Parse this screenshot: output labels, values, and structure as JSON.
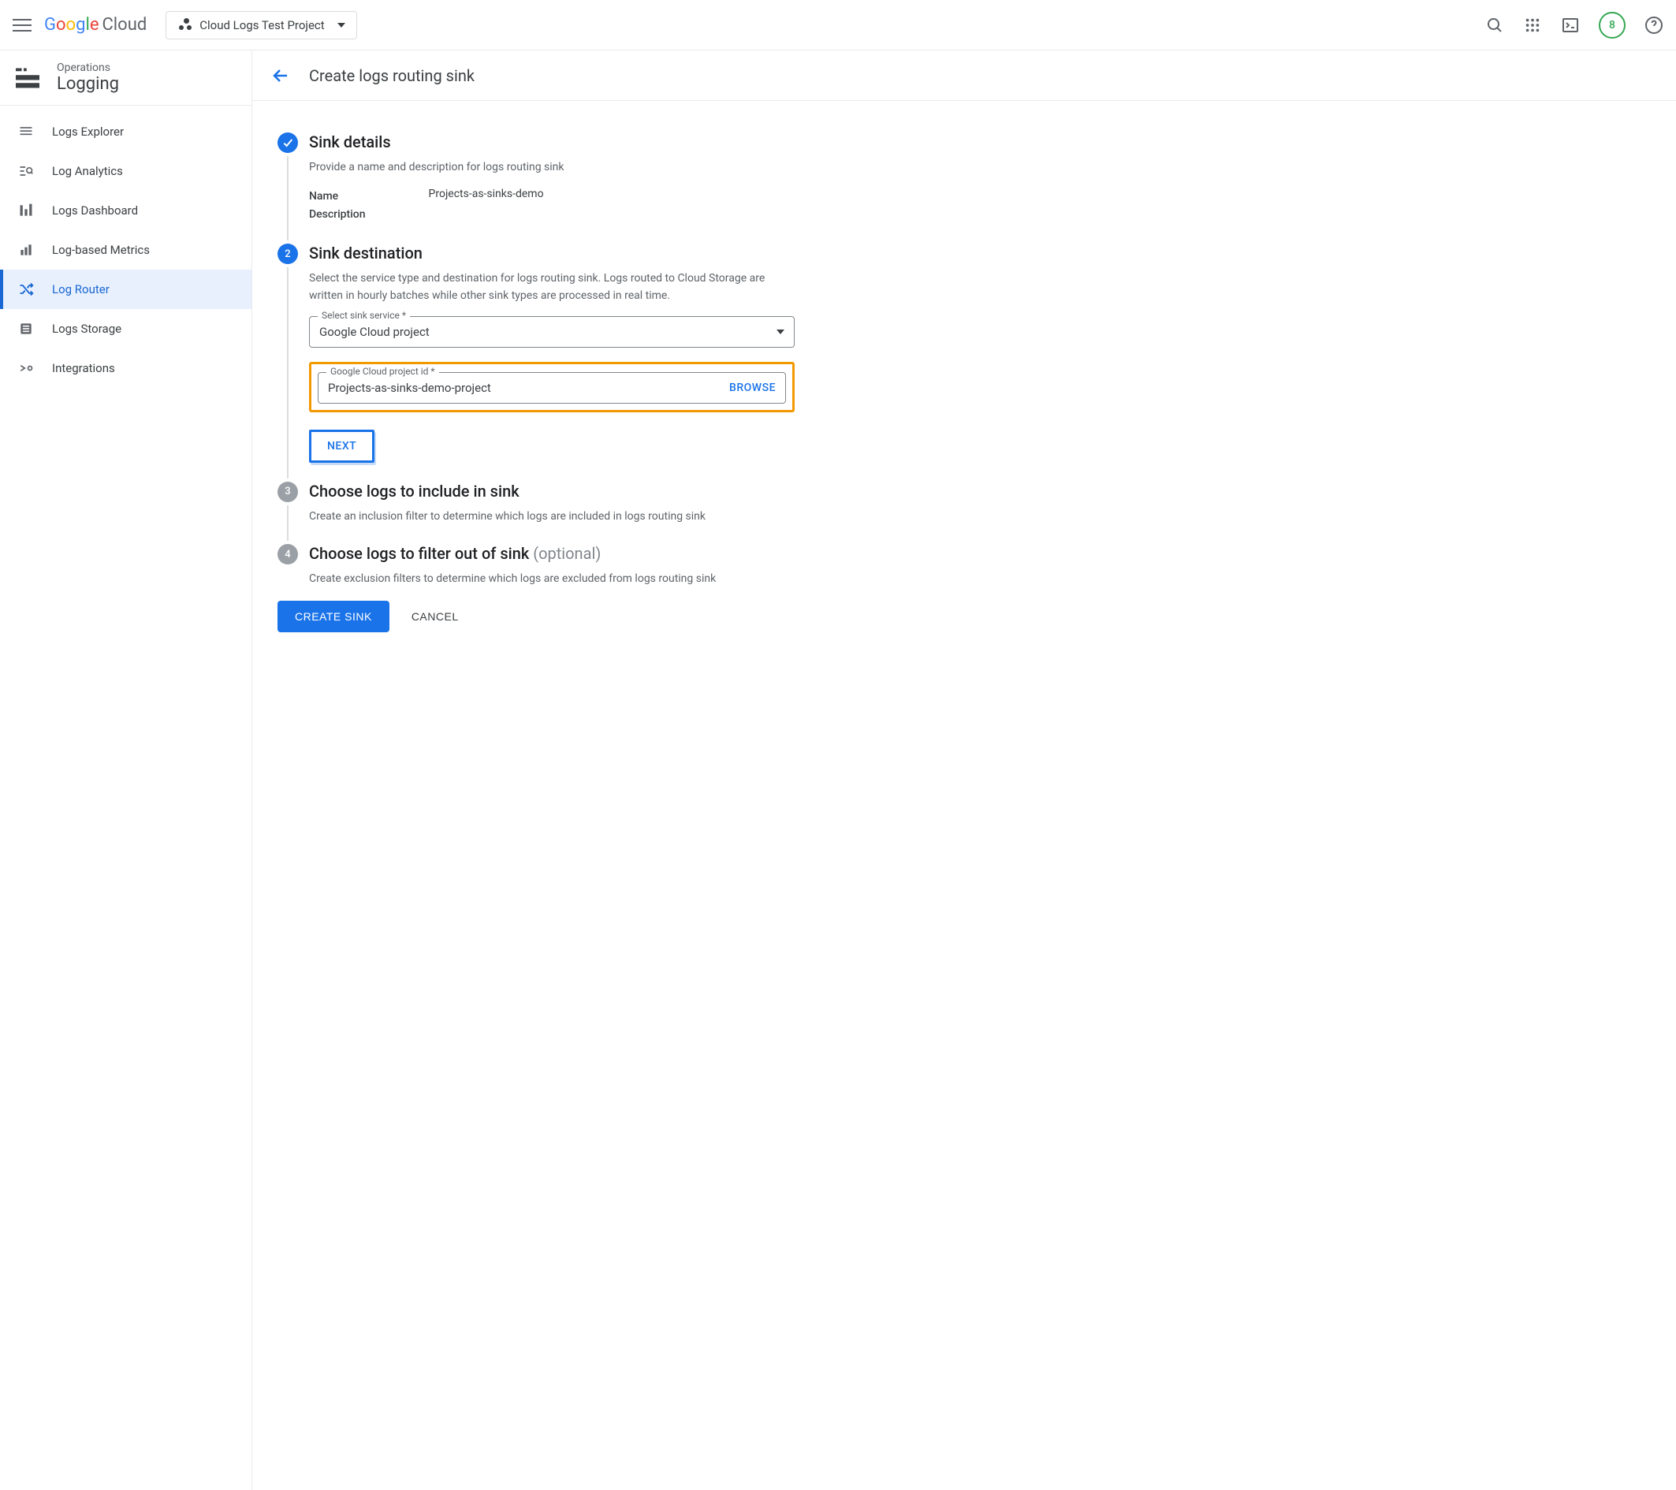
{
  "header": {
    "logo_cloud": "Cloud",
    "project_name": "Cloud Logs Test Project",
    "badge_count": "8"
  },
  "sidebar": {
    "operations": "Operations",
    "logging": "Logging",
    "items": [
      {
        "label": "Logs Explorer"
      },
      {
        "label": "Log Analytics"
      },
      {
        "label": "Logs Dashboard"
      },
      {
        "label": "Log-based Metrics"
      },
      {
        "label": "Log Router"
      },
      {
        "label": "Logs Storage"
      },
      {
        "label": "Integrations"
      }
    ]
  },
  "main": {
    "title": "Create logs routing sink",
    "steps": {
      "s1": {
        "title": "Sink details",
        "desc": "Provide a name and description for logs routing sink",
        "name_label": "Name",
        "desc_label": "Description",
        "name_value": "Projects-as-sinks-demo"
      },
      "s2": {
        "num": "2",
        "title": "Sink destination",
        "desc": "Select the service type and destination for logs routing sink. Logs routed to Cloud Storage are written in hourly batches while other sink types are processed in real time.",
        "service_label": "Select sink service *",
        "service_value": "Google Cloud project",
        "project_label": "Google Cloud project id *",
        "project_value": "Projects-as-sinks-demo-project",
        "browse": "BROWSE",
        "next": "NEXT"
      },
      "s3": {
        "num": "3",
        "title": "Choose logs to include in sink",
        "desc": "Create an inclusion filter to determine which logs are included in logs routing sink"
      },
      "s4": {
        "num": "4",
        "title": "Choose logs to filter out of sink ",
        "optional": "(optional)",
        "desc": "Create exclusion filters to determine which logs are excluded from logs routing sink"
      }
    },
    "footer": {
      "create": "CREATE SINK",
      "cancel": "CANCEL"
    }
  }
}
